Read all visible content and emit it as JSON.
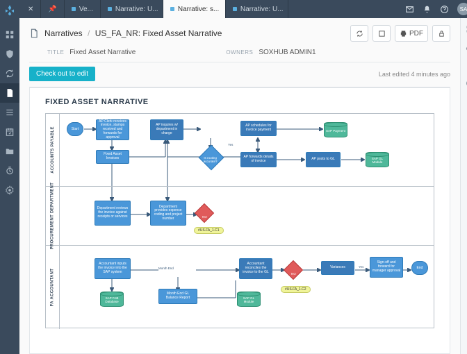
{
  "sidebar": {
    "items": [
      "dashboard",
      "shield",
      "refresh",
      "document",
      "list",
      "calendar",
      "folder",
      "clock",
      "settings"
    ],
    "active": "document"
  },
  "tabs": [
    {
      "label": "",
      "pinned": true,
      "closable": true
    },
    {
      "label": "",
      "pinned": true
    },
    {
      "label": "Ve..."
    },
    {
      "label": "Narrative: U..."
    },
    {
      "label": "Narrative: s...",
      "active": true
    },
    {
      "label": "Narrative: U..."
    }
  ],
  "topbar": {
    "avatar_initials": "SA"
  },
  "breadcrumb": {
    "parent": "Narratives",
    "current": "US_FA_NR: Fixed Asset Narrative"
  },
  "toolbar": {
    "pdf_label": "PDF"
  },
  "meta": {
    "title_label": "TITLE",
    "title_value": "Fixed Asset Narrative",
    "owners_label": "OWNERS",
    "owners_value": "SOXHUB ADMIN1"
  },
  "edit": {
    "checkout_label": "Check out to edit",
    "last_edited": "Last edited 4 minutes ago"
  },
  "document": {
    "title": "FIXED ASSET NARRATIVE",
    "lanes": [
      "ACCOUNTS PAYABLE",
      "PROCUREMENT DEPARTMENT",
      "FA ACCOUNTANT"
    ],
    "nodes": {
      "start": "Start",
      "ap_clerk": "AP Clerk receives invoice, stamps received and forwards for approval",
      "ap_inquires": "AP inquires w/ department in charge",
      "ap_schedules": "AP schedules for invoice payment",
      "sap_payment": "SAP Payment",
      "fixed_asset_inv": "Fixed Asset Invoices",
      "routing": "Is routing accurate?",
      "ap_forwards": "AP forwards details of invoice",
      "ap_posts": "AP posts to GL",
      "sap_gl": "SAP GL Module",
      "dept_reviews": "Department reviews the invoice against receipts or services",
      "dept_provides": "Department provides expense coding and project number",
      "ref1": "#US.FA_1.C1",
      "acct_inputs": "Accountant inputs the invoice into the SAP system",
      "month_end_label": "Month End",
      "acct_reconciles": "Accountant reconciles the invoice to the GL",
      "variances": "Variances",
      "signoff": "Sign-off and forward for manager approval",
      "end": "End",
      "sap_fab": "SAP FAB Database",
      "month_end_gl": "Month End GL Balance Report",
      "sap_gl2": "SAP GL Module",
      "ref2": "#US.FA_1.C2",
      "yes": "Yes",
      "yes2": "Yes",
      "no": "NO"
    }
  }
}
